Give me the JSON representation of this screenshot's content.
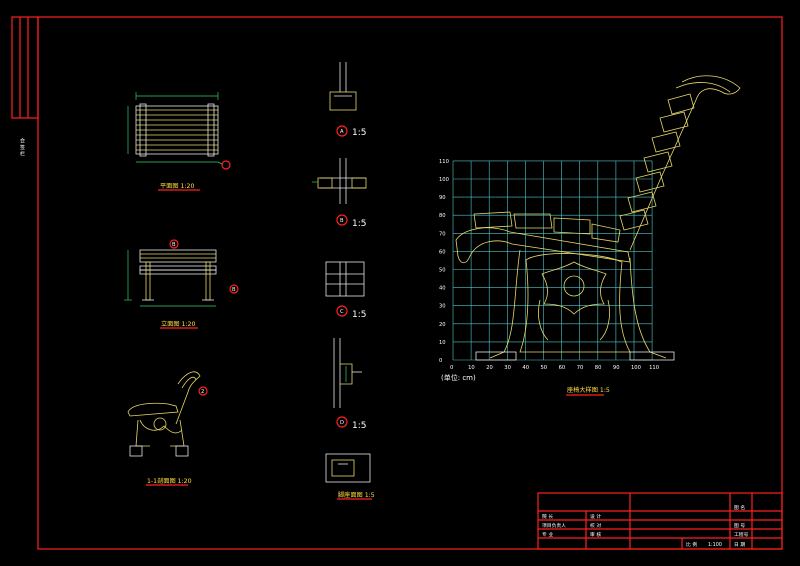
{
  "side_stamp": "会 签 栏",
  "views": {
    "plan": "平面图 1:20",
    "elevation": "立面图 1:20",
    "section": "1-1剖面图 1:20",
    "detail_a_scale": "1:5",
    "detail_b_scale": "1:5",
    "detail_c_scale": "1:5",
    "detail_d_scale": "1:5",
    "foot_plan": "脚座面图 1:5",
    "large": "座椅大样图 1:5"
  },
  "markers": {
    "a": "A",
    "b": "B",
    "c": "C",
    "d": "D",
    "one": "1",
    "two": "2"
  },
  "grid": {
    "unit_label": "(单位: cm)",
    "x_ticks": [
      "0",
      "10",
      "20",
      "30",
      "40",
      "50",
      "60",
      "70",
      "80",
      "90",
      "100",
      "110"
    ],
    "y_ticks": [
      "0",
      "10",
      "20",
      "30",
      "40",
      "50",
      "60",
      "70",
      "80",
      "90",
      "100",
      "110"
    ]
  },
  "title_block": {
    "r1c1": "院 长",
    "r1c2": "设 计",
    "r2c1": "项目负责人",
    "r2c2": "校 对",
    "r3c1": "专 业",
    "r3c2": "审 核",
    "r4c2": "比 例",
    "r4c3": "1:100",
    "c_right_1": "图 名",
    "c_right_2": "图 号",
    "c_right_3": "工程号",
    "c_right_4": "日 期"
  },
  "colors": {
    "background": "#000000",
    "frame": "#ff2020",
    "grid": "#4fc8c8",
    "line_white": "#e8e8e8",
    "line_yellow": "#e8d86a",
    "label_yellow": "#ffe040"
  }
}
